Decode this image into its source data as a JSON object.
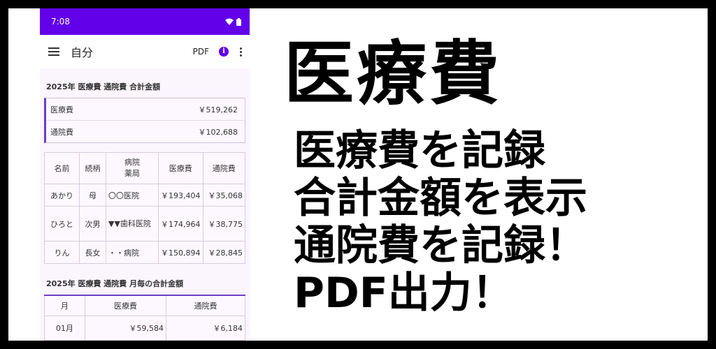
{
  "status": {
    "time": "7:08"
  },
  "appbar": {
    "title": "自分",
    "pdf": "PDF"
  },
  "section1": {
    "title": "2025年 医療費 通院費 合計金額"
  },
  "summary": [
    {
      "label": "医療費",
      "value": "￥519,262"
    },
    {
      "label": "通院費",
      "value": "￥102,688"
    }
  ],
  "table1": {
    "headers": [
      "名前",
      "続柄",
      "病院\n薬局",
      "医療費",
      "通院費"
    ],
    "rows": [
      [
        "あかり",
        "母",
        "〇〇医院",
        "￥193,404",
        "￥35,068"
      ],
      [
        "ひろと",
        "次男",
        "▼▼歯科医院",
        "￥174,964",
        "￥38,775"
      ],
      [
        "りん",
        "長女",
        "・・病院",
        "￥150,894",
        "￥28,845"
      ]
    ]
  },
  "section2": {
    "title": "2025年 医療費 通院費 月毎の合計金額"
  },
  "table2": {
    "headers": [
      "月",
      "医療費",
      "通院費"
    ],
    "rows": [
      [
        "01月",
        "￥59,584",
        "￥6,184"
      ]
    ]
  },
  "promo": {
    "headline": "医療費",
    "lines": [
      "医療費を記録",
      "合計金額を表示",
      "通院費を記録！",
      "PDF出力！"
    ]
  },
  "colors": {
    "statusbar": "#6200ea",
    "accent": "#6b3fc5",
    "content_bg": "#fbf5fe"
  }
}
